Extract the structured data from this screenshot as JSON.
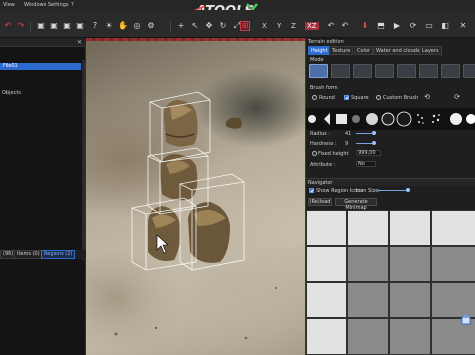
{
  "menubar": {
    "items": [
      "View",
      "Windows",
      "Settings",
      "?"
    ],
    "logo_text": "ATOOLS"
  },
  "toolbar": {
    "icons": [
      "undo-icon",
      "redo-icon",
      "camera-icon",
      "camera-icon",
      "camera-icon",
      "camera-icon",
      "help-icon",
      "sun-icon",
      "hand-icon",
      "globe-icon",
      "gear-icon",
      "add-icon",
      "select-icon",
      "move-icon",
      "rotate-icon",
      "scale-icon",
      "snap-icon",
      "axis-x",
      "axis-y",
      "axis-z",
      "axis-xz",
      "undo-icon",
      "undo-icon",
      "save-icon",
      "build-icon",
      "play-icon",
      "refresh-icon",
      "close-icon"
    ],
    "axis_x": "X",
    "axis_y": "Y",
    "axis_z": "Z",
    "axis_xz": "XZ"
  },
  "left_panel": {
    "file_item": "File01",
    "objects_label": "Objects",
    "tabs": [
      {
        "label": "Items (0)",
        "active": false
      },
      {
        "label": "Regions (2)",
        "active": true
      }
    ],
    "first_tab_partial": "(96)"
  },
  "terrain": {
    "title": "Terrain edition",
    "tabs": [
      {
        "label": "Height",
        "active": true
      },
      {
        "label": "Texture",
        "active": false
      },
      {
        "label": "Color",
        "active": false
      },
      {
        "label": "Water and clouds",
        "active": false
      },
      {
        "label": "Layers",
        "active": false
      }
    ],
    "mode_label": "Mode",
    "brush_form_label": "Brush form",
    "brush_round": "Round",
    "brush_square": "Square",
    "brush_custom": "Custom Brush",
    "radius_label": "Radius :",
    "radius_value": "41",
    "hardness_label": "Hardness :",
    "hardness_value": "9",
    "fixed_height_label": "Fixed height",
    "fixed_height_value": "999,00",
    "attribute_label": "Attribute :",
    "attribute_value": "No"
  },
  "navigator": {
    "title": "Navigator",
    "show_region_icons": "Show Region Icons",
    "icon_size_label": "Icon Size:",
    "reload_label": "(Re)load",
    "generate_label": "Generate Minimap"
  },
  "colors": {
    "accent": "#2e6bd0",
    "panel_bg": "#1f1f1f",
    "selection_box": "#ffffff"
  }
}
